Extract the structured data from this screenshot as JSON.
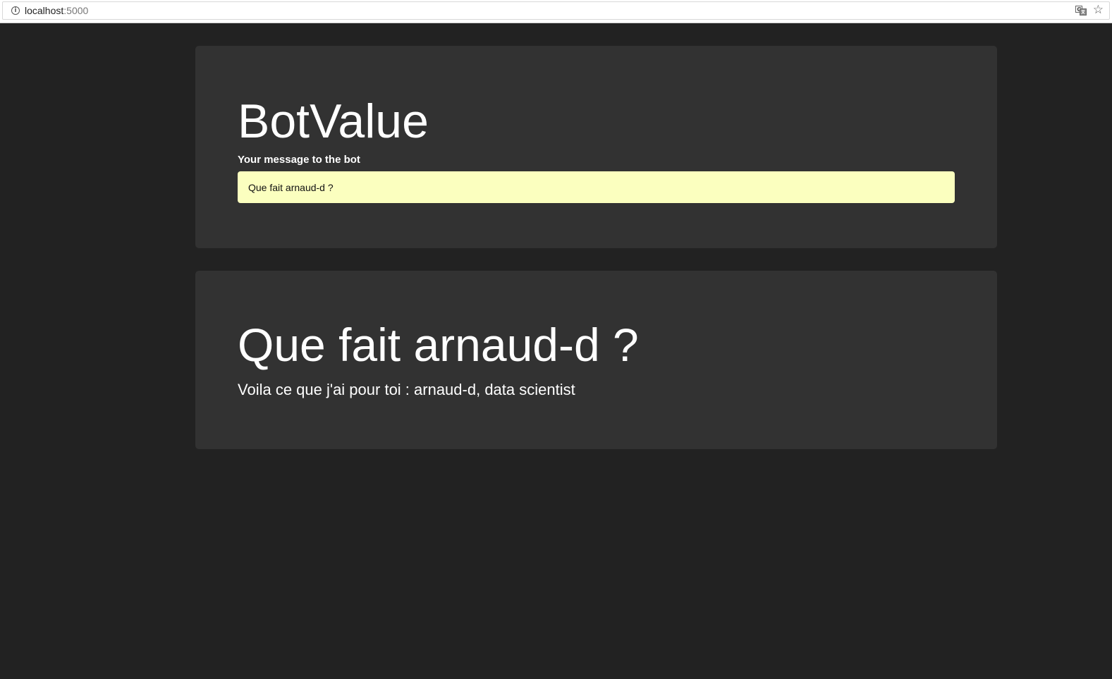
{
  "browser": {
    "url_host": "localhost",
    "url_port": ":5000",
    "icons": [
      "info-icon",
      "translate-icon",
      "star-icon"
    ]
  },
  "form": {
    "title": "BotValue",
    "label": "Your message to the bot",
    "input_value": "Que fait arnaud-d ?"
  },
  "response": {
    "question": "Que fait arnaud-d ?",
    "answer": "Voila ce que j'ai pour toi : arnaud-d, data scientist"
  },
  "colors": {
    "page_background": "#222222",
    "card_background": "#323232",
    "input_background": "#fbffbf",
    "text": "#ffffff"
  }
}
